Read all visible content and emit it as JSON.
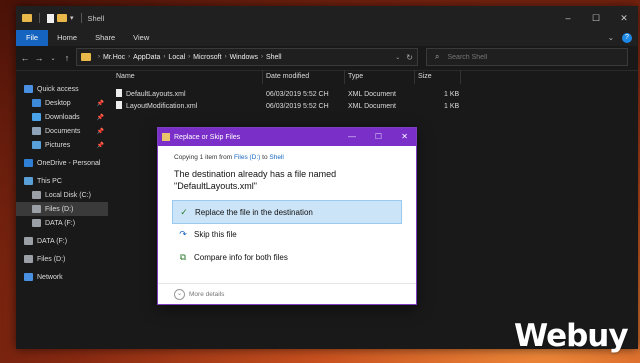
{
  "window": {
    "title": "Shell",
    "controls": [
      "–",
      "☐",
      "✕"
    ]
  },
  "ribbon": {
    "tabs": [
      "File",
      "Home",
      "Share",
      "View"
    ]
  },
  "address": {
    "crumbs": [
      "Mr.Hoc",
      "AppData",
      "Local",
      "Microsoft",
      "Windows",
      "Shell"
    ],
    "search_placeholder": "Search Shell"
  },
  "sidebar": {
    "items": [
      {
        "label": "Quick access",
        "icon": "star-icon",
        "pinned": false,
        "indent": 0
      },
      {
        "label": "Desktop",
        "icon": "desktop-icon",
        "pinned": true,
        "indent": 1
      },
      {
        "label": "Downloads",
        "icon": "download-icon",
        "pinned": true,
        "indent": 1
      },
      {
        "label": "Documents",
        "icon": "documents-icon",
        "pinned": true,
        "indent": 1
      },
      {
        "label": "Pictures",
        "icon": "pictures-icon",
        "pinned": true,
        "indent": 1
      },
      {
        "label": "OneDrive - Personal",
        "icon": "cloud-icon",
        "pinned": false,
        "indent": 0
      },
      {
        "label": "This PC",
        "icon": "pc-icon",
        "pinned": false,
        "indent": 0
      },
      {
        "label": "Local Disk (C:)",
        "icon": "disk-icon",
        "pinned": false,
        "indent": 1
      },
      {
        "label": "Files (D:)",
        "icon": "disk-icon",
        "pinned": false,
        "indent": 1,
        "selected": true
      },
      {
        "label": "DATA (F:)",
        "icon": "disk-icon",
        "pinned": false,
        "indent": 1
      },
      {
        "label": "DATA (F:)",
        "icon": "disk-icon",
        "pinned": false,
        "indent": 0
      },
      {
        "label": "Files (D:)",
        "icon": "disk-icon",
        "pinned": false,
        "indent": 0
      },
      {
        "label": "Network",
        "icon": "network-icon",
        "pinned": false,
        "indent": 0
      }
    ]
  },
  "columns": [
    "Name",
    "Date modified",
    "Type",
    "Size"
  ],
  "files": [
    {
      "name": "DefaultLayouts.xml",
      "date": "06/03/2019 5:52 CH",
      "type": "XML Document",
      "size": "1 KB"
    },
    {
      "name": "LayoutModification.xml",
      "date": "06/03/2019 5:52 CH",
      "type": "XML Document",
      "size": "1 KB"
    }
  ],
  "dialog": {
    "title": "Replace or Skip Files",
    "copying_prefix": "Copying 1 item from ",
    "from": "Files (D:)",
    "to_word": " to ",
    "to": "Shell",
    "question_line1": "The destination already has a file named",
    "question_line2": "\"DefaultLayouts.xml\"",
    "options": [
      {
        "label": "Replace the file in the destination",
        "icon": "check-icon",
        "selected": true
      },
      {
        "label": "Skip this file",
        "icon": "skip-icon",
        "selected": false
      },
      {
        "label": "Compare info for both files",
        "icon": "compare-icon",
        "selected": false
      }
    ],
    "more_details": "More details"
  },
  "watermark": "Webuy"
}
